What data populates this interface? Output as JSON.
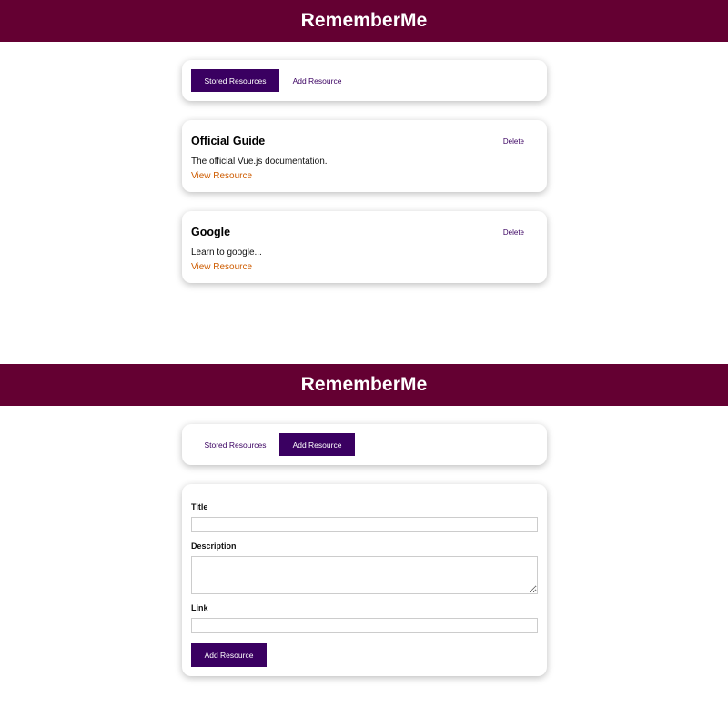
{
  "app": {
    "title": "RememberMe"
  },
  "tabs": {
    "stored_label": "Stored Resources",
    "add_label": "Add Resource"
  },
  "resources": [
    {
      "title": "Official Guide",
      "description": "The official Vue.js documentation.",
      "link_label": "View Resource",
      "delete_label": "Delete"
    },
    {
      "title": "Google",
      "description": "Learn to google...",
      "link_label": "View Resource",
      "delete_label": "Delete"
    }
  ],
  "form": {
    "title_label": "Title",
    "title_value": "",
    "description_label": "Description",
    "description_value": "",
    "link_label": "Link",
    "link_value": "",
    "submit_label": "Add Resource"
  },
  "colors": {
    "header": "#640032",
    "accent": "#3a0061",
    "link": "#ce5c00"
  }
}
